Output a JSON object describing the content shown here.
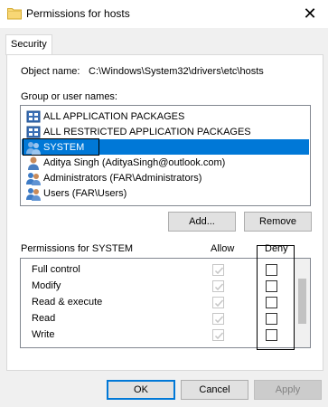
{
  "window": {
    "title": "Permissions for hosts",
    "icon": "folder-icon",
    "close_glyph": "✕"
  },
  "tabs": [
    {
      "label": "Security",
      "active": true
    }
  ],
  "object": {
    "label": "Object name:",
    "value": "C:\\Windows\\System32\\drivers\\etc\\hosts"
  },
  "group": {
    "label": "Group or user names:",
    "items": [
      {
        "label": "ALL APPLICATION PACKAGES",
        "icon": "package-group-icon",
        "selected": false
      },
      {
        "label": "ALL RESTRICTED APPLICATION PACKAGES",
        "icon": "package-group-icon",
        "selected": false
      },
      {
        "label": "SYSTEM",
        "icon": "users-group-icon",
        "selected": true
      },
      {
        "label": "Aditya Singh (AdityaSingh@outlook.com)",
        "icon": "user-icon",
        "selected": false
      },
      {
        "label": "Administrators (FAR\\Administrators)",
        "icon": "users-group-icon",
        "selected": false
      },
      {
        "label": "Users (FAR\\Users)",
        "icon": "users-group-icon",
        "selected": false
      }
    ],
    "add_label": "Add...",
    "remove_label": "Remove"
  },
  "permissions": {
    "header": "Permissions for SYSTEM",
    "allow_header": "Allow",
    "deny_header": "Deny",
    "rows": [
      {
        "name": "Full control",
        "allow": true,
        "deny": false
      },
      {
        "name": "Modify",
        "allow": true,
        "deny": false
      },
      {
        "name": "Read & execute",
        "allow": true,
        "deny": false
      },
      {
        "name": "Read",
        "allow": true,
        "deny": false
      },
      {
        "name": "Write",
        "allow": true,
        "deny": false
      }
    ]
  },
  "footer": {
    "ok_label": "OK",
    "cancel_label": "Cancel",
    "apply_label": "Apply"
  },
  "colors": {
    "selection": "#0078d7",
    "disabled_text": "#838383"
  }
}
